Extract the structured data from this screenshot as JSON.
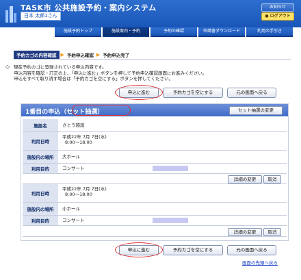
{
  "header": {
    "app_title": "TASK市 公共施設予約・案内システム",
    "user_name": "日本 太郎1さん",
    "help_label": "お知らせ",
    "logout_label": "● ログアウト"
  },
  "nav": [
    "施設予約トップ",
    "施設案内・予約",
    "予約の確認",
    "申請書ダウンロード",
    "利用の手引き"
  ],
  "steps": {
    "active": "予約カゴの内容確認",
    "step2": "予約申込確認",
    "step3": "予約申込完了"
  },
  "instructions": [
    "現在予約カゴに登録されている申込内容です。",
    "申込内容を確認・訂正の上、「申込に進む」ボタンを押して予約申込確認画面にお進みください。",
    "申込をすべて取り消す場合は「予約カゴを空にする」ボタンを押してください。"
  ],
  "buttons": {
    "submit": "申込に進む",
    "empty": "予約カゴを空にする",
    "back": "元の画面へ戻る"
  },
  "panel": {
    "title_prefix": "1番目の申込",
    "title_set": "（セット抽選）",
    "set_change": "セット抽選の変更",
    "facility_label": "施設名",
    "facility_value": "さとう施設",
    "date_label": "利用日時",
    "place_label": "施設内の場所",
    "purpose_label": "利用目的",
    "detail_btn": "詳細の変更",
    "cancel_btn": "取消",
    "entries": [
      {
        "date_line1": "平成22年 7月 7日(水)",
        "date_line2": "8:00〜18:00",
        "place": "大ホール",
        "purpose": "コンサート"
      },
      {
        "date_line1": "平成22年 7月 7日(水)",
        "date_line2": "8:00〜18:00",
        "place": "小ホール",
        "purpose": "コンサート"
      }
    ]
  },
  "top_link": "画面の先頭へ戻る"
}
